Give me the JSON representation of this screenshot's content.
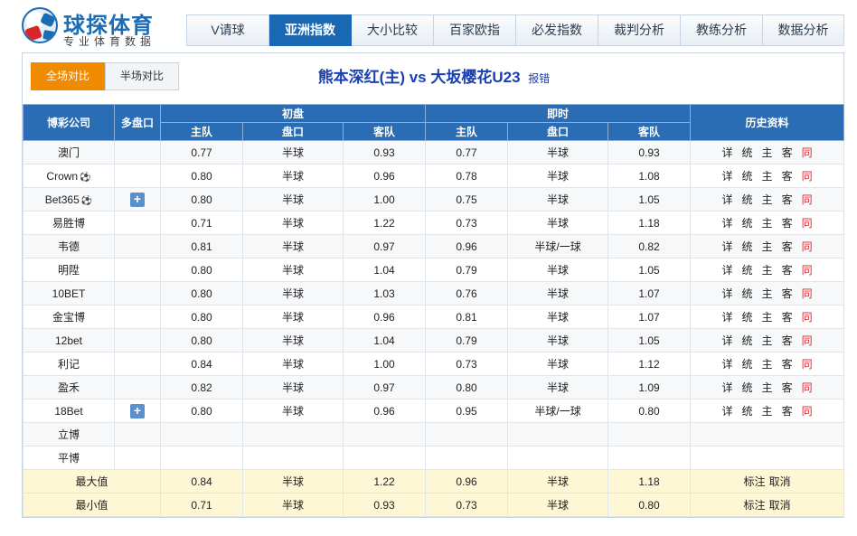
{
  "brand": {
    "name": "球探体育",
    "tagline": "专业体育数据"
  },
  "nav": {
    "tabs": [
      {
        "label": "V请球",
        "active": false,
        "width": 91
      },
      {
        "label": "亚洲指数",
        "active": true,
        "width": 91
      },
      {
        "label": "大小比较",
        "active": false,
        "width": 91
      },
      {
        "label": "百家欧指",
        "active": false,
        "width": 91
      },
      {
        "label": "必发指数",
        "active": false,
        "width": 91
      },
      {
        "label": "裁判分析",
        "active": false,
        "width": 91
      },
      {
        "label": "教练分析",
        "active": false,
        "width": 91
      },
      {
        "label": "数据分析",
        "active": false,
        "width": 90
      }
    ]
  },
  "half_tabs": {
    "full": "全场对比",
    "half": "半场对比"
  },
  "match": {
    "title": "熊本深红(主) vs 大坂樱花U23",
    "report": "报错"
  },
  "table": {
    "headers": {
      "company": "博彩公司",
      "multi": "多盘口",
      "initial": "初盘",
      "live": "即时",
      "history": "历史资料",
      "home": "主队",
      "handicap": "盘口",
      "away": "客队"
    },
    "history_links": [
      "详",
      "统",
      "主",
      "客",
      "同"
    ],
    "rows": [
      {
        "company": "澳门",
        "ball": false,
        "plus": false,
        "i_home": "0.77",
        "i_hcp": "半球",
        "i_away": "0.93",
        "l_home": "0.77",
        "l_hcp": "半球",
        "l_away": "0.93",
        "history": true
      },
      {
        "company": "Crown",
        "ball": true,
        "plus": false,
        "i_home": "0.80",
        "i_hcp": "半球",
        "i_away": "0.96",
        "l_home": "0.78",
        "l_hcp": "半球",
        "l_away": "1.08",
        "history": true
      },
      {
        "company": "Bet365",
        "ball": true,
        "plus": true,
        "i_home": "0.80",
        "i_hcp": "半球",
        "i_away": "1.00",
        "l_home": "0.75",
        "l_hcp": "半球",
        "l_away": "1.05",
        "history": true
      },
      {
        "company": "易胜博",
        "ball": false,
        "plus": false,
        "i_home": "0.71",
        "i_hcp": "半球",
        "i_away": "1.22",
        "l_home": "0.73",
        "l_hcp": "半球",
        "l_away": "1.18",
        "history": true
      },
      {
        "company": "韦德",
        "ball": false,
        "plus": false,
        "i_home": "0.81",
        "i_hcp": "半球",
        "i_away": "0.97",
        "l_home": "0.96",
        "l_hcp": "半球/一球",
        "l_away": "0.82",
        "history": true
      },
      {
        "company": "明陞",
        "ball": false,
        "plus": false,
        "i_home": "0.80",
        "i_hcp": "半球",
        "i_away": "1.04",
        "l_home": "0.79",
        "l_hcp": "半球",
        "l_away": "1.05",
        "history": true
      },
      {
        "company": "10BET",
        "ball": false,
        "plus": false,
        "i_home": "0.80",
        "i_hcp": "半球",
        "i_away": "1.03",
        "l_home": "0.76",
        "l_hcp": "半球",
        "l_away": "1.07",
        "history": true
      },
      {
        "company": "金宝博",
        "ball": false,
        "plus": false,
        "i_home": "0.80",
        "i_hcp": "半球",
        "i_away": "0.96",
        "l_home": "0.81",
        "l_hcp": "半球",
        "l_away": "1.07",
        "history": true
      },
      {
        "company": "12bet",
        "ball": false,
        "plus": false,
        "i_home": "0.80",
        "i_hcp": "半球",
        "i_away": "1.04",
        "l_home": "0.79",
        "l_hcp": "半球",
        "l_away": "1.05",
        "history": true
      },
      {
        "company": "利记",
        "ball": false,
        "plus": false,
        "i_home": "0.84",
        "i_hcp": "半球",
        "i_away": "1.00",
        "l_home": "0.73",
        "l_hcp": "半球",
        "l_away": "1.12",
        "history": true
      },
      {
        "company": "盈禾",
        "ball": false,
        "plus": false,
        "i_home": "0.82",
        "i_hcp": "半球",
        "i_away": "0.97",
        "l_home": "0.80",
        "l_hcp": "半球",
        "l_away": "1.09",
        "history": true
      },
      {
        "company": "18Bet",
        "ball": false,
        "plus": true,
        "i_home": "0.80",
        "i_hcp": "半球",
        "i_away": "0.96",
        "l_home": "0.95",
        "l_hcp": "半球/一球",
        "l_away": "0.80",
        "history": true
      },
      {
        "company": "立博",
        "ball": false,
        "plus": false,
        "i_home": "",
        "i_hcp": "",
        "i_away": "",
        "l_home": "",
        "l_hcp": "",
        "l_away": "",
        "history": false
      },
      {
        "company": "平博",
        "ball": false,
        "plus": false,
        "i_home": "",
        "i_hcp": "",
        "i_away": "",
        "l_home": "",
        "l_hcp": "",
        "l_away": "",
        "history": false
      }
    ],
    "summary": [
      {
        "label": "最大值",
        "i_home": "0.84",
        "i_hcp": "半球",
        "i_away": "1.22",
        "l_home": "0.96",
        "l_hcp": "半球",
        "l_away": "1.18",
        "mark": "标注",
        "cancel": "取消"
      },
      {
        "label": "最小值",
        "i_home": "0.71",
        "i_hcp": "半球",
        "i_away": "0.93",
        "l_home": "0.73",
        "l_hcp": "半球",
        "l_away": "0.80",
        "mark": "标注",
        "cancel": "取消"
      }
    ]
  },
  "colors": {
    "accent": "#1a67b3",
    "header_bg": "#2a6db5",
    "orange": "#f08a00",
    "red": "#d9262c",
    "summary_bg": "#fdf7d6"
  },
  "icons": {
    "ball": "soccer-ball-icon",
    "plus": "plus-icon"
  }
}
